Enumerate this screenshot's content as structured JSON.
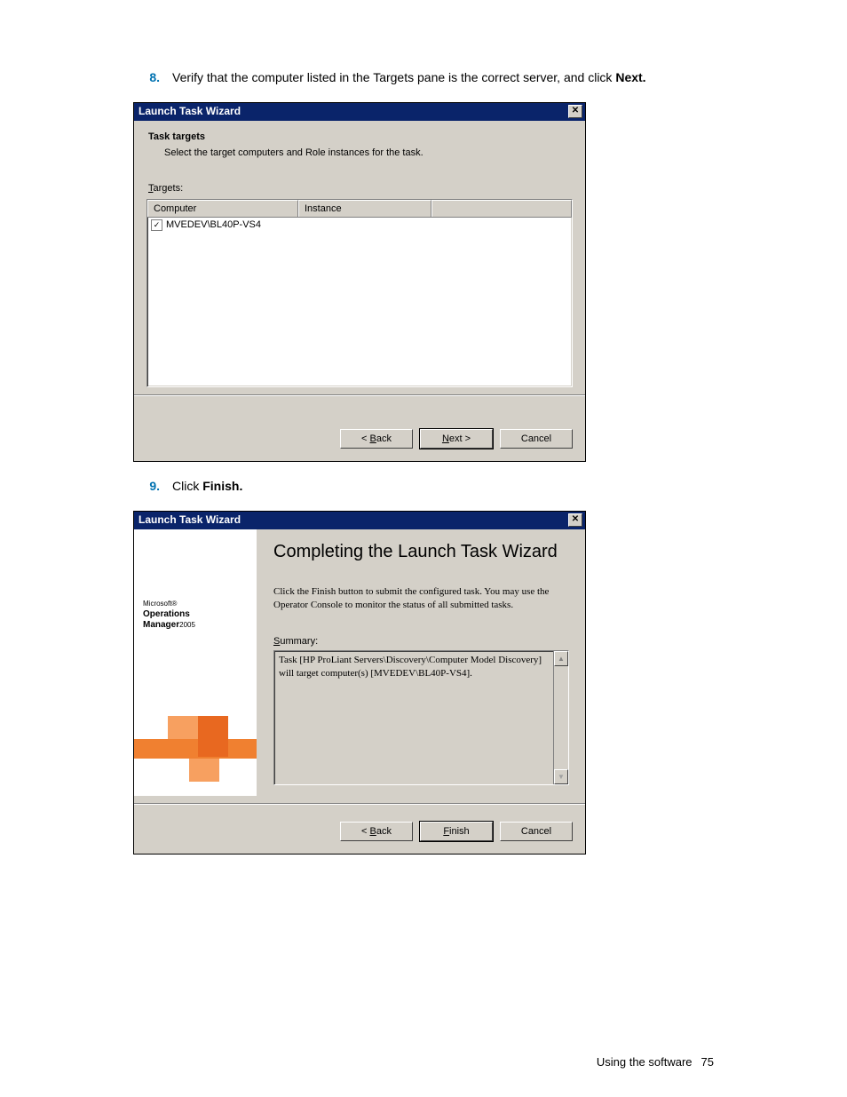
{
  "step8": {
    "num": "8.",
    "text_before": "Verify that the computer listed in the Targets pane is the correct server, and click ",
    "bold": "Next.",
    "text_after": ""
  },
  "step9": {
    "num": "9.",
    "text_before": "Click ",
    "bold": "Finish.",
    "text_after": ""
  },
  "dialog1": {
    "title": "Launch Task Wizard",
    "heading": "Task targets",
    "subtitle": "Select the target computers and Role instances for the task.",
    "targets_label": "Targets:",
    "col_computer": "Computer",
    "col_instance": "Instance",
    "row_computer": "MVEDEV\\BL40P-VS4",
    "check_mark": "✓",
    "btn_back": "< Back",
    "btn_next": "Next >",
    "btn_cancel": "Cancel"
  },
  "dialog2": {
    "title": "Launch Task Wizard",
    "side_small": "Microsoft®",
    "side_line1": "Operations",
    "side_line2": "Manager",
    "side_year": "2005",
    "heading": "Completing the Launch Task Wizard",
    "para": "Click the Finish button to submit the configured task. You may use the Operator Console to monitor the status of all submitted tasks.",
    "summary_label": "Summary:",
    "summary_text": "Task [HP ProLiant Servers\\Discovery\\Computer Model Discovery] will target computer(s) [MVEDEV\\BL40P-VS4].",
    "btn_back": "< Back",
    "btn_finish": "Finish",
    "btn_cancel": "Cancel"
  },
  "footer": {
    "text": "Using the software",
    "page": "75"
  }
}
